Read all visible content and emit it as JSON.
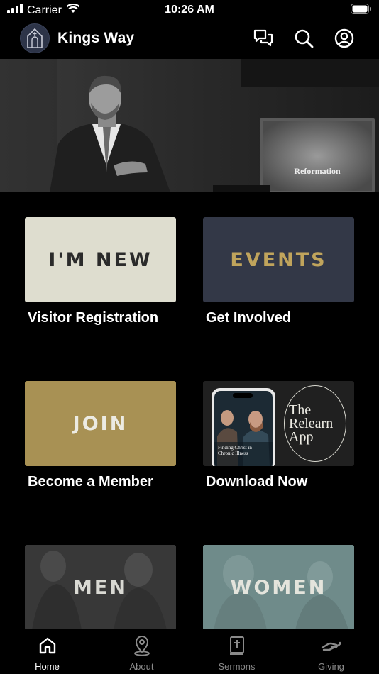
{
  "status_bar": {
    "carrier": "Carrier",
    "time": "10:26 AM"
  },
  "header": {
    "title": "Kings Way",
    "icons": [
      "chat-icon",
      "search-icon",
      "profile-icon"
    ]
  },
  "tiles": [
    {
      "word": "I'M NEW",
      "caption": "Visitor Registration",
      "bg": "#deddcf",
      "fg": "#2b2b2b"
    },
    {
      "word": "EVENTS",
      "caption": "Get Involved",
      "bg": "#333847",
      "fg": "#c0a45c"
    },
    {
      "word": "JOIN",
      "caption": "Become a Member",
      "bg": "#a89154",
      "fg": "#ecebe3"
    },
    {
      "promo_title": [
        "The",
        "Relearn",
        "App"
      ],
      "phone_text": "Finding Christ in Chronic Illness",
      "caption": "Download Now",
      "bg": "#202020",
      "fg": "#ecebe3"
    },
    {
      "word": "MEN",
      "caption": "",
      "bg": "#3a3a3a",
      "fg": "#d9d9d3"
    },
    {
      "word": "WOMEN",
      "caption": "",
      "bg": "#6f8b8a",
      "fg": "#e4e4dc"
    }
  ],
  "hero": {
    "screen_text": "Reformation"
  },
  "tabbar": {
    "items": [
      {
        "label": "Home",
        "icon": "home-icon",
        "active": true
      },
      {
        "label": "About",
        "icon": "location-pin-icon",
        "active": false
      },
      {
        "label": "Sermons",
        "icon": "bible-icon",
        "active": false
      },
      {
        "label": "Giving",
        "icon": "giving-hand-icon",
        "active": false
      }
    ]
  }
}
